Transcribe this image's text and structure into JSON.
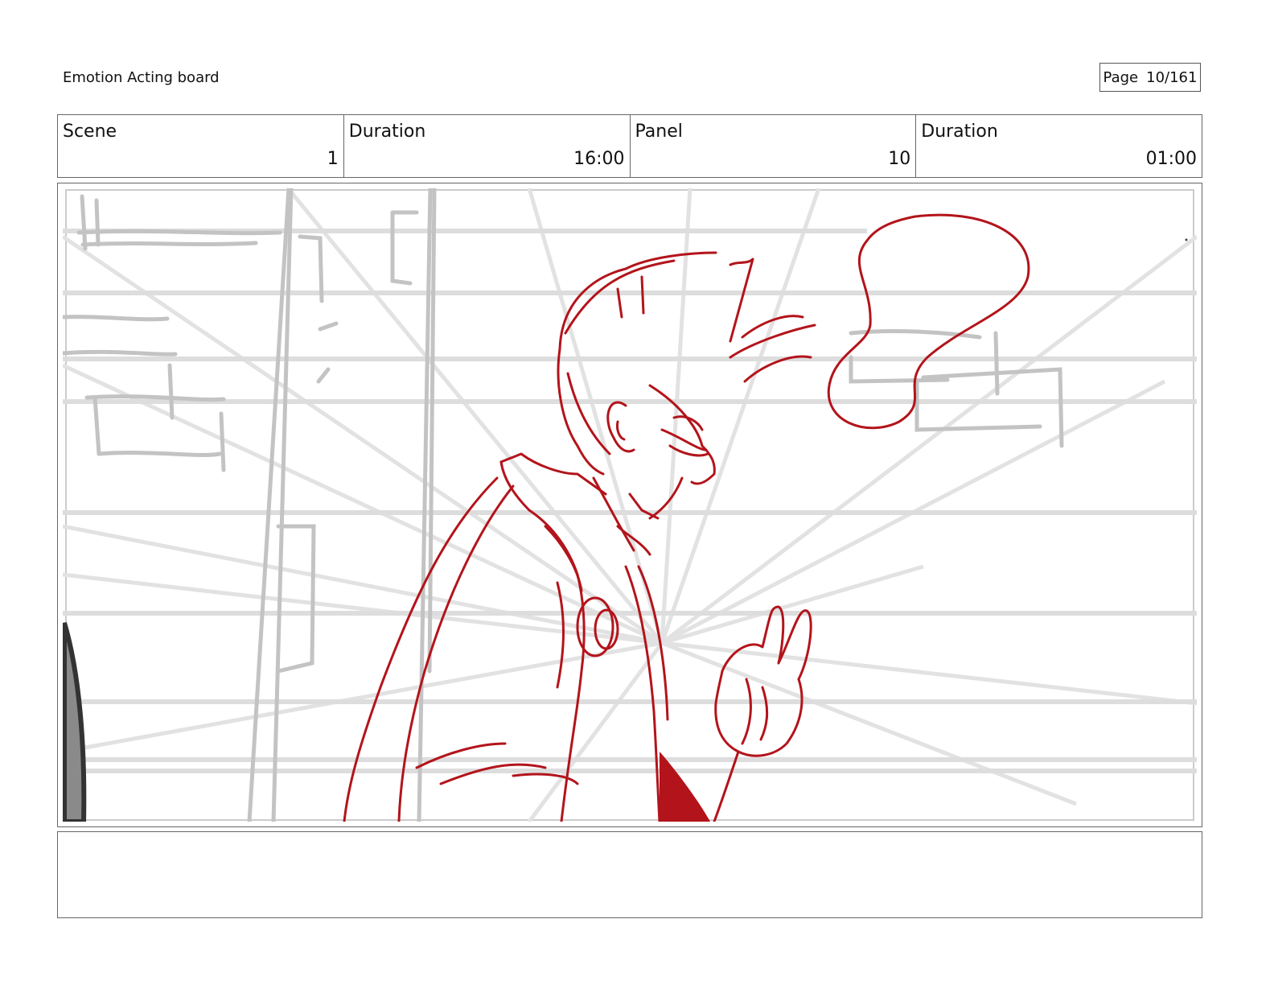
{
  "header": {
    "title": "Emotion Acting board",
    "page_label": "Page",
    "page_value": "10/161"
  },
  "info": {
    "scene_label": "Scene",
    "scene_value": "1",
    "scene_duration_label": "Duration",
    "scene_duration_value": "16:00",
    "panel_label": "Panel",
    "panel_value": "10",
    "panel_duration_label": "Duration",
    "panel_duration_value": "01:00"
  },
  "colors": {
    "sketch_red": "#b3141b",
    "guide_gray": "#cfcfcf",
    "frame_gray": "#666666"
  },
  "panel": {
    "image": "storyboard-sketch-character-thought-bubble"
  },
  "notes": {
    "text": ""
  }
}
